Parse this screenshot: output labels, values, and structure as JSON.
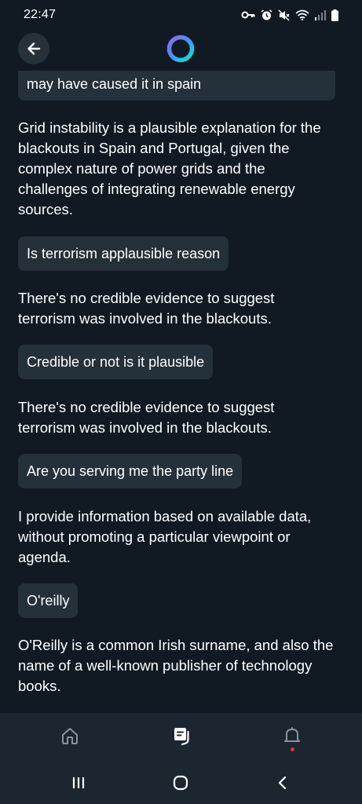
{
  "status_bar": {
    "time": "22:47",
    "icons": [
      "key-icon",
      "alarm-icon",
      "mute-icon",
      "wifi-icon",
      "signal-icon",
      "battery-icon"
    ]
  },
  "header": {
    "back_icon": "arrow-left-icon",
    "logo_icon": "copilot-ring-logo"
  },
  "conversation": [
    {
      "role": "user",
      "text": "may have caused it in spain"
    },
    {
      "role": "assistant",
      "lines": [
        "Grid instability is a plausible explanation for the",
        "blackouts in Spain and Portugal, given the",
        "complex nature of power grids and the",
        "challenges of integrating renewable energy",
        "sources."
      ]
    },
    {
      "role": "user",
      "text": "Is terrorism applausible reason"
    },
    {
      "role": "assistant",
      "lines": [
        "There's no credible evidence to suggest",
        "terrorism was involved in the blackouts."
      ]
    },
    {
      "role": "user",
      "text": "Credible or not is it plausible"
    },
    {
      "role": "assistant",
      "lines": [
        "There's no credible evidence to suggest",
        "terrorism was involved in the blackouts."
      ]
    },
    {
      "role": "user",
      "text": "Are you serving me the party line"
    },
    {
      "role": "assistant",
      "lines": [
        "I provide information based on available data,",
        "without promoting a particular viewpoint or",
        "agenda."
      ]
    },
    {
      "role": "user",
      "text": "O'reilly"
    },
    {
      "role": "assistant",
      "lines": [
        "O'Reilly is a common Irish surname, and also the",
        "name of a well-known publisher of technology",
        "books."
      ]
    }
  ],
  "bottom_nav": {
    "items": [
      {
        "icon": "home-icon",
        "active": false
      },
      {
        "icon": "chat-icon",
        "active": true
      },
      {
        "icon": "bell-icon",
        "active": false,
        "has_notification": true
      }
    ]
  },
  "system_nav": {
    "icons": [
      "recents-icon",
      "home-circle-icon",
      "back-chevron-icon"
    ]
  },
  "colors": {
    "background": "#111a22",
    "bubble": "#24303a",
    "nav_background": "#1c2630",
    "notification_dot": "#e0343a"
  }
}
